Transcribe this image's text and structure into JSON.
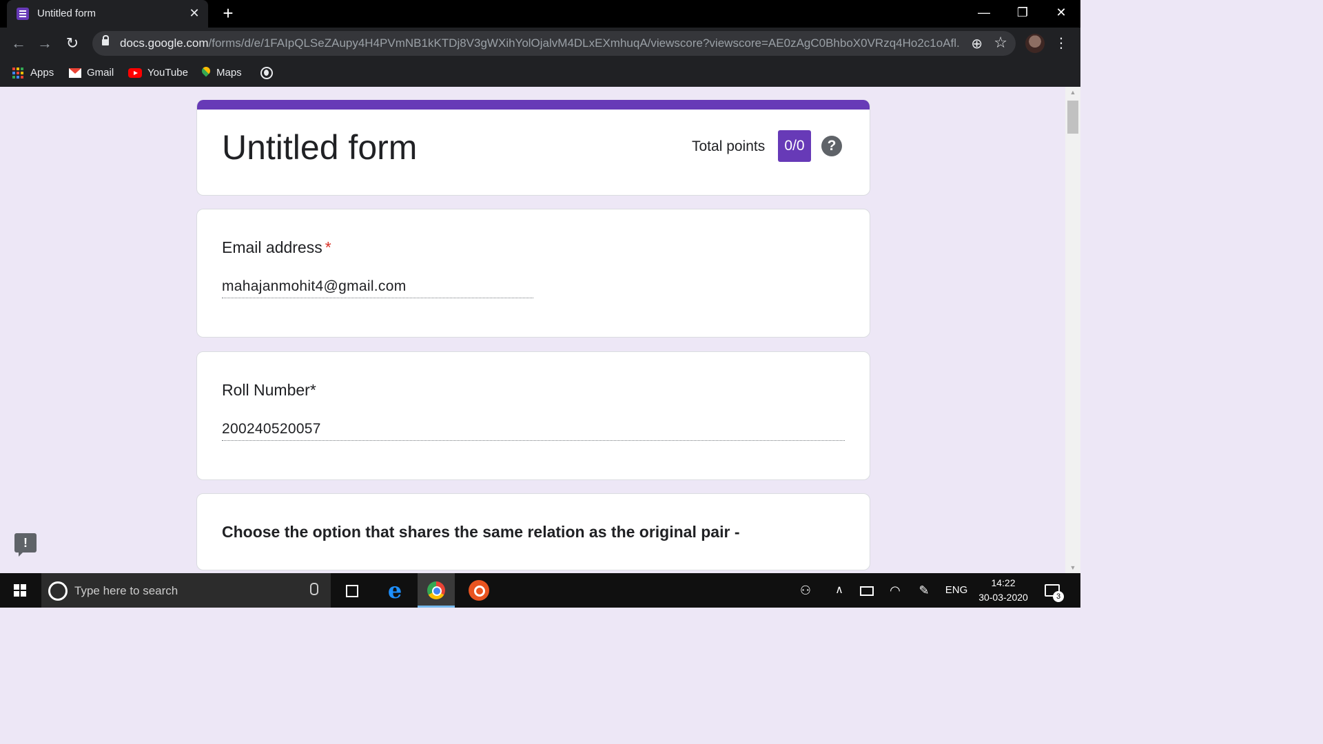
{
  "browser": {
    "tab_title": "Untitled form",
    "url_host": "docs.google.com",
    "url_path": "/forms/d/e/1FAIpQLSeZAupy4H4PVmNB1kKTDj8V3gWXihYolOjalvM4DLxEXmhuqA/viewscore?viewscore=AE0zAgC0BhboX0VRzq4Ho2c1oAfl..."
  },
  "bookmarks": [
    {
      "label": "Apps",
      "icon": "apps-grid-icon"
    },
    {
      "label": "Gmail",
      "icon": "gmail-icon"
    },
    {
      "label": "YouTube",
      "icon": "youtube-icon"
    },
    {
      "label": "Maps",
      "icon": "maps-icon"
    }
  ],
  "form": {
    "title": "Untitled form",
    "total_points_label": "Total points",
    "score": "0/0",
    "accent_color": "#673ab7",
    "background_color": "#ede7f6",
    "questions": [
      {
        "label": "Email address",
        "required_mark": "*",
        "answer": "mahajanmohit4@gmail.com"
      },
      {
        "label": "Roll Number*",
        "answer": "200240520057"
      },
      {
        "label": "Choose the option that shares the same relation as the original pair -"
      }
    ]
  },
  "taskbar": {
    "search_placeholder": "Type here to search",
    "language": "ENG",
    "time": "14:22",
    "date": "30-03-2020",
    "notification_count": "3"
  }
}
